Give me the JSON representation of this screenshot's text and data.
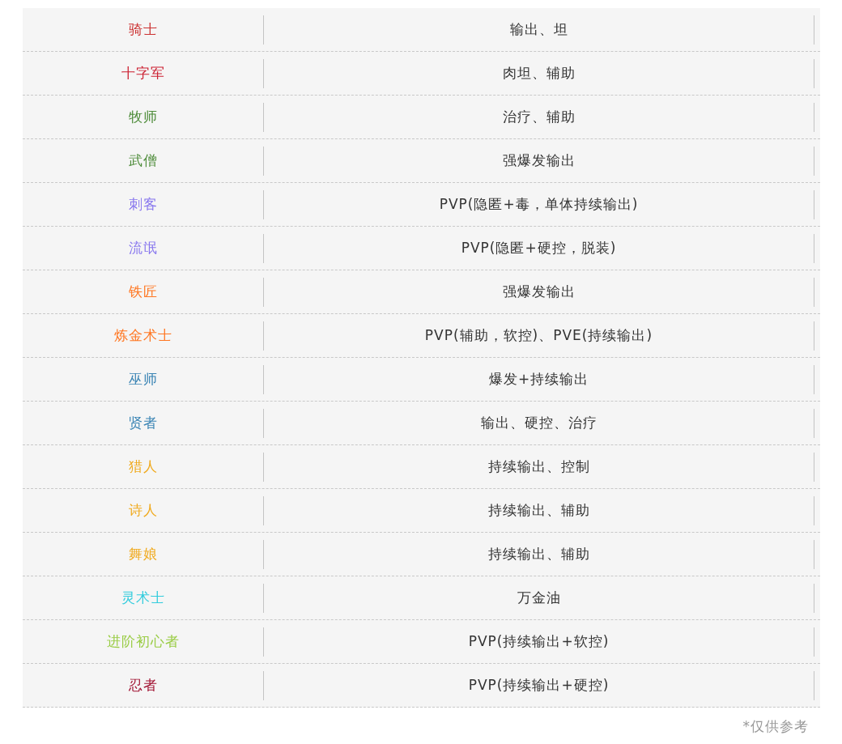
{
  "rows": [
    {
      "class_name": "骑士",
      "color": "#cc3333",
      "role": "输出、坦"
    },
    {
      "class_name": "十字军",
      "color": "#cc2233",
      "role": "肉坦、辅助"
    },
    {
      "class_name": "牧师",
      "color": "#4e8c3a",
      "role": "治疗、辅助"
    },
    {
      "class_name": "武僧",
      "color": "#4e8c3a",
      "role": "强爆发输出"
    },
    {
      "class_name": "刺客",
      "color": "#8877ee",
      "role": "PVP(隐匿+毒，单体持续输出)"
    },
    {
      "class_name": "流氓",
      "color": "#8877ee",
      "role": "PVP(隐匿+硬控，脱装)"
    },
    {
      "class_name": "铁匠",
      "color": "#ff7722",
      "role": "强爆发输出"
    },
    {
      "class_name": "炼金术士",
      "color": "#ff7722",
      "role": "PVP(辅助，软控)、PVE(持续输出)"
    },
    {
      "class_name": "巫师",
      "color": "#3a84b4",
      "role": "爆发+持续输出"
    },
    {
      "class_name": "贤者",
      "color": "#3a84b4",
      "role": "输出、硬控、治疗"
    },
    {
      "class_name": "猎人",
      "color": "#f0aa1e",
      "role": "持续输出、控制"
    },
    {
      "class_name": "诗人",
      "color": "#f0aa1e",
      "role": "持续输出、辅助"
    },
    {
      "class_name": "舞娘",
      "color": "#f0aa1e",
      "role": "持续输出、辅助"
    },
    {
      "class_name": "灵术士",
      "color": "#33ccdd",
      "role": "万金油"
    },
    {
      "class_name": "进阶初心者",
      "color": "#99cc44",
      "role": "PVP(持续输出+软控)"
    },
    {
      "class_name": "忍者",
      "color": "#a01030",
      "role": "PVP(持续输出+硬控)"
    }
  ],
  "footnote": "*仅供参考"
}
